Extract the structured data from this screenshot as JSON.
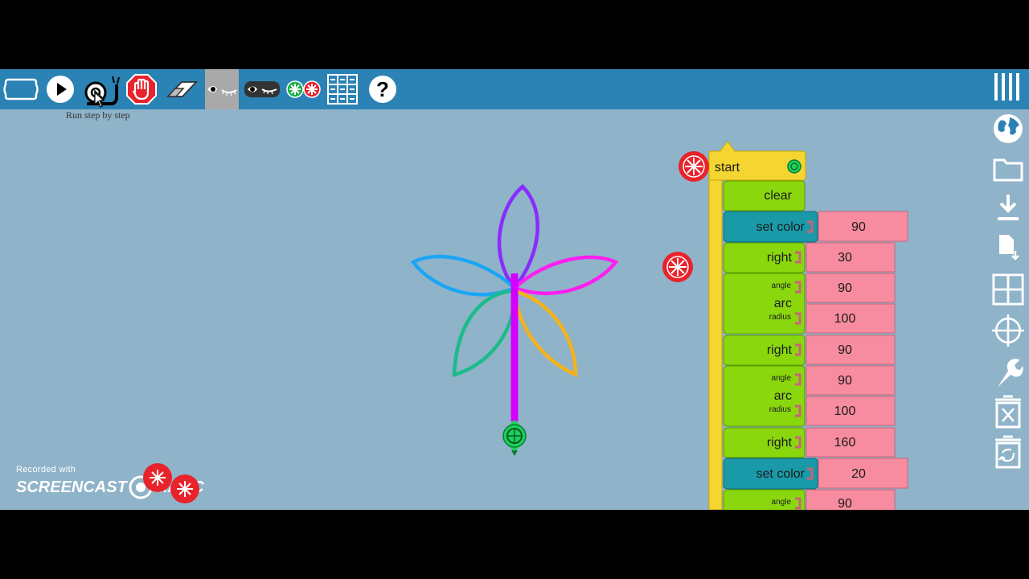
{
  "toolbar": {
    "tooltip": "Run step by step",
    "help_label": "?",
    "items": [
      {
        "name": "workspace-toggle-button",
        "icon": "screen-icon"
      },
      {
        "name": "run-button",
        "icon": "play-icon"
      },
      {
        "name": "run-step-button",
        "icon": "snail-icon"
      },
      {
        "name": "stop-button",
        "icon": "stop-hand-icon"
      },
      {
        "name": "clear-button",
        "icon": "eraser-icon"
      },
      {
        "name": "show-turtle-button",
        "icon": "eye-icon"
      },
      {
        "name": "hide-turtle-button",
        "icon": "eye-closed-icon"
      },
      {
        "name": "blocks-toggle-button",
        "icon": "blocks-icon"
      },
      {
        "name": "grid-button",
        "icon": "grid-icon"
      },
      {
        "name": "help-button",
        "icon": "help-icon"
      }
    ]
  },
  "sidebar": [
    {
      "name": "menu-button",
      "icon": "menu-icon"
    },
    {
      "name": "language-button",
      "icon": "globe-icon"
    },
    {
      "name": "open-button",
      "icon": "folder-icon"
    },
    {
      "name": "save-button",
      "icon": "download-icon"
    },
    {
      "name": "save-plugin-button",
      "icon": "file-download-icon"
    },
    {
      "name": "grid-toggle-button",
      "icon": "grid-icon"
    },
    {
      "name": "center-button",
      "icon": "crosshair-icon"
    },
    {
      "name": "settings-button",
      "icon": "wrench-icon"
    },
    {
      "name": "trash-button",
      "icon": "trash-icon"
    },
    {
      "name": "restore-button",
      "icon": "restore-icon"
    }
  ],
  "blocks": {
    "start": "start",
    "clear": "clear",
    "set_color_1": "set color",
    "set_color_1_value": "90",
    "right_1": "right",
    "right_1_value": "30",
    "arc_1": "arc",
    "arc_1_angle_label": "angle",
    "arc_1_angle": "90",
    "arc_1_radius_label": "radius",
    "arc_1_radius": "100",
    "right_2": "right",
    "right_2_value": "90",
    "arc_2": "arc",
    "arc_2_angle_label": "angle",
    "arc_2_angle": "90",
    "arc_2_radius_label": "radius",
    "arc_2_radius": "100",
    "right_3": "right",
    "right_3_value": "160",
    "set_color_2": "set color",
    "set_color_2_value": "20",
    "arc_3_angle_label": "angle",
    "arc_3_angle": "90"
  },
  "watermark": {
    "recorded": "Recorded with",
    "brand_left": "SCREENCAST",
    "brand_right": "MATIC"
  },
  "colors": {
    "background": "#8fb3c9",
    "toolbar": "#2b82b4",
    "start_block": "#f5d531",
    "action_block": "#8ad70e",
    "pen_block": "#1a9aa8",
    "number_block": "#f78ca0",
    "petal_purple": "#8a2bff",
    "petal_blue": "#1aa6f5",
    "petal_magenta": "#ff1ff0",
    "petal_teal": "#1cbb8a",
    "petal_orange": "#f5b21a",
    "stem": "#d400ff",
    "turtle": "#1ad15a"
  }
}
